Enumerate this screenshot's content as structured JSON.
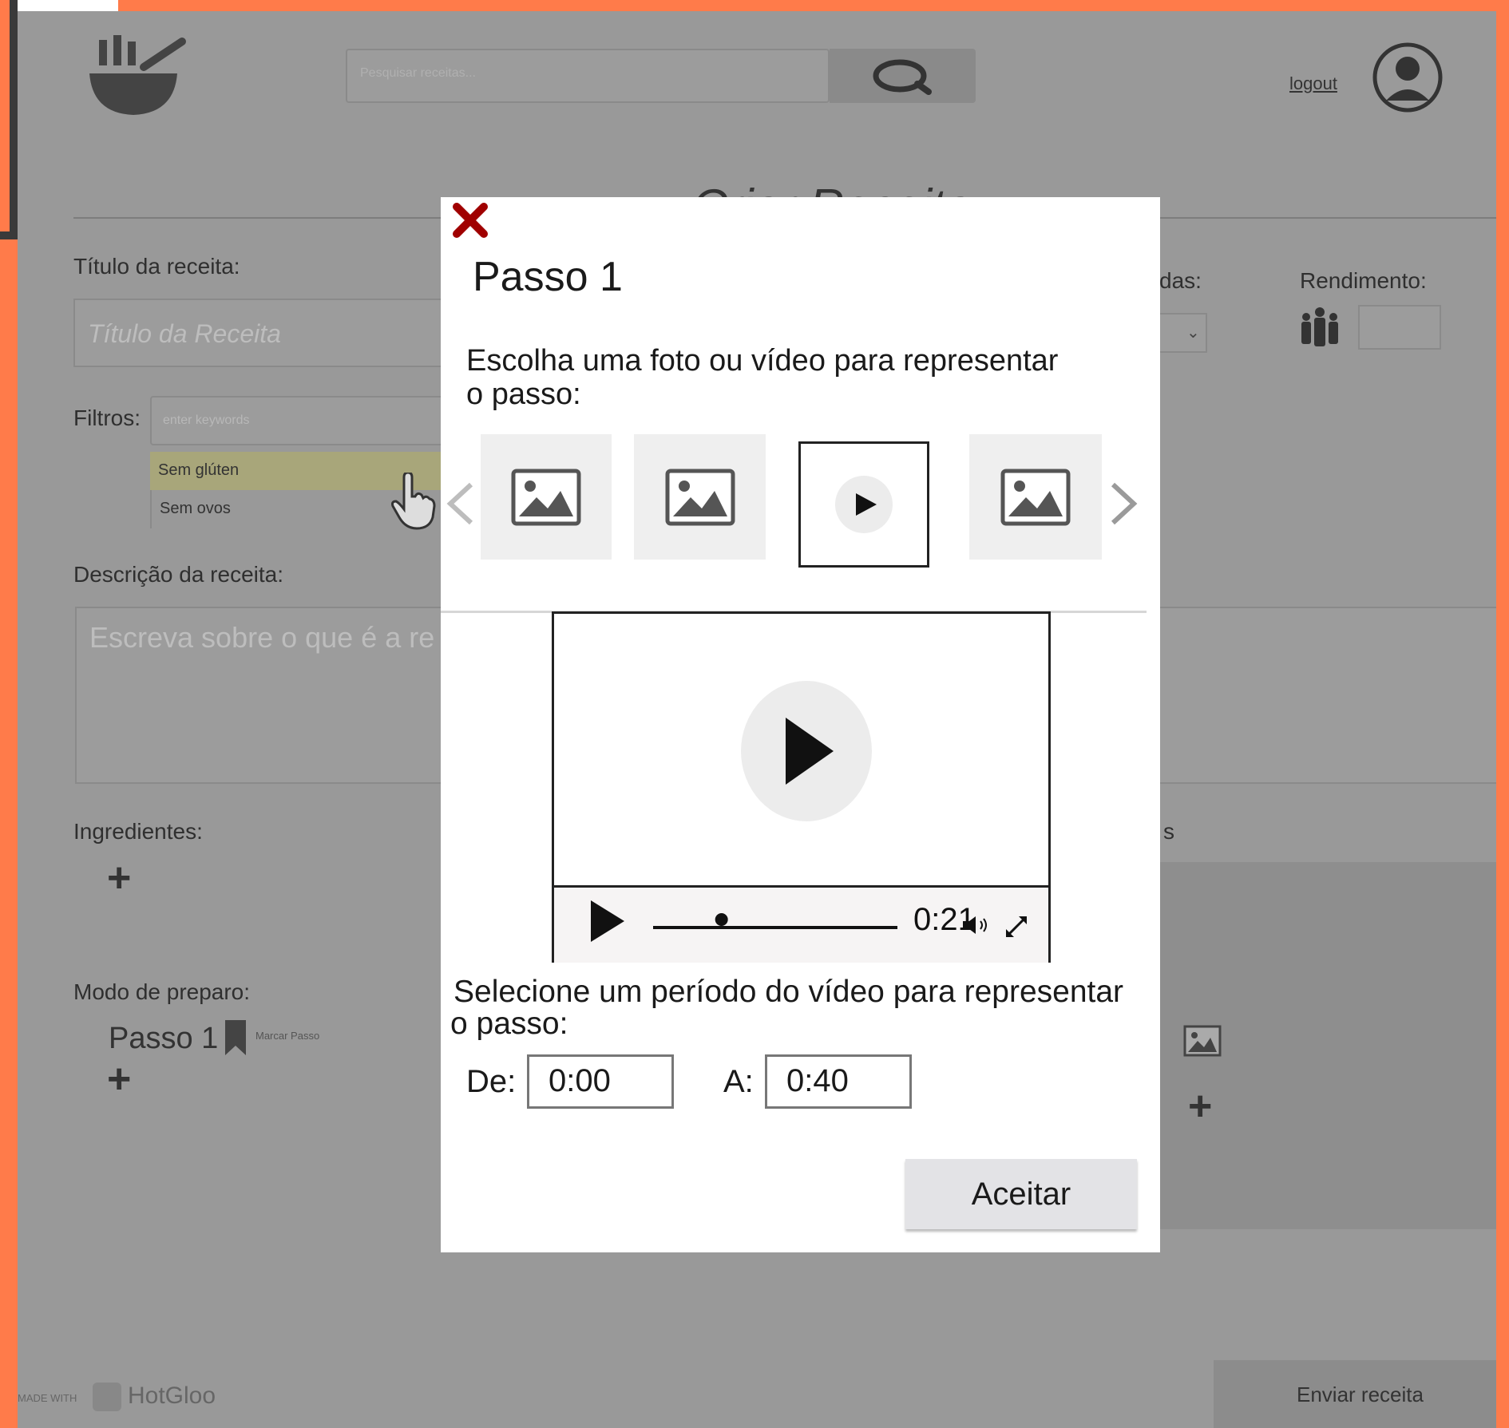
{
  "header": {
    "search_placeholder": "Pesquisar receitas...",
    "logout_label": "logout",
    "page_title": "Criar Receita"
  },
  "form": {
    "title_label": "Título da receita:",
    "title_placeholder": "Título da Receita",
    "filters_label": "Filtros:",
    "filters_placeholder": "enter keywords",
    "filter_options": [
      "Sem glúten",
      "Sem ovos"
    ],
    "description_label": "Descrição da receita:",
    "description_placeholder": "Escreva sobre o que é a re",
    "ingredients_label": "Ingredientes:",
    "preparation_label": "Modo de preparo:",
    "step_label": "Passo 1",
    "mark_step_label": "Marcar Passo",
    "portions_partial_label": "das:",
    "yield_label": "Rendimento:",
    "utensils_partial_label": "s",
    "submit_label": "Enviar receita"
  },
  "footer": {
    "made_with": "MADE WITH",
    "brand": "HotGloo"
  },
  "modal": {
    "title": "Passo 1",
    "choose_prompt_line1": "Escolha uma foto ou vídeo para representar",
    "choose_prompt_line2": "o passo:",
    "thumbnails": [
      {
        "type": "image",
        "selected": false
      },
      {
        "type": "image",
        "selected": false
      },
      {
        "type": "video",
        "selected": true
      },
      {
        "type": "image",
        "selected": false
      }
    ],
    "video": {
      "current_time": "0:21",
      "progress": 0.28
    },
    "select_period_line1": "Selecione um período do vídeo para representar",
    "select_period_line2": "o passo:",
    "from_label": "De:",
    "from_value": "0:00",
    "to_label": "A:",
    "to_value": "0:40",
    "accept_label": "Aceitar"
  },
  "colors": {
    "frame": "#ff7b4a",
    "overlay": "#999999",
    "close": "#a00000",
    "filter_highlight": "#a8a67a"
  }
}
